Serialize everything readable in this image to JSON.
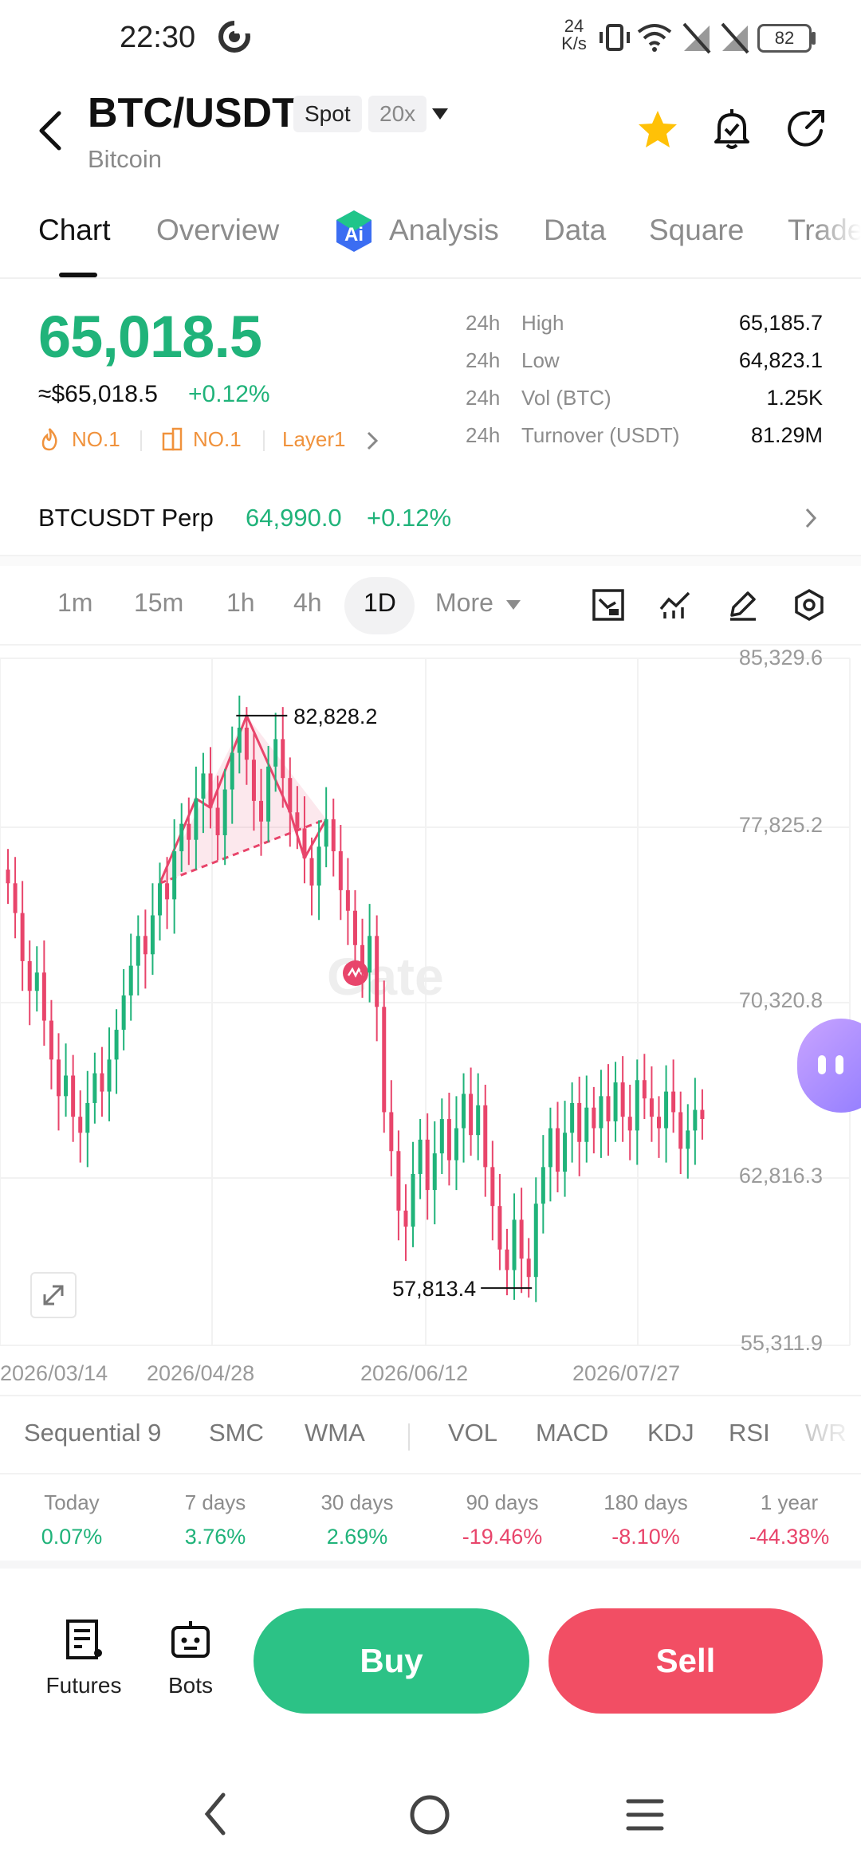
{
  "status_bar": {
    "time": "22:30",
    "net_speed_top": "24",
    "net_speed_bottom": "K/s",
    "battery": "82"
  },
  "header": {
    "title": "BTC/USDT",
    "subtitle": "Bitcoin",
    "spot_chip": "Spot",
    "leverage_chip": "20x"
  },
  "tabs": [
    {
      "label": "Chart"
    },
    {
      "label": "Overview"
    },
    {
      "label": "Analysis"
    },
    {
      "label": "Data"
    },
    {
      "label": "Square"
    },
    {
      "label": "Trade"
    }
  ],
  "price": {
    "last": "65,018.5",
    "usd": "≈$65,018.5",
    "change": "+0.12%",
    "tags": [
      "NO.1",
      "NO.1",
      "Layer1"
    ]
  },
  "stats": [
    {
      "period": "24h",
      "key": "High",
      "value": "65,185.7"
    },
    {
      "period": "24h",
      "key": "Low",
      "value": "64,823.1"
    },
    {
      "period": "24h",
      "key": "Vol (BTC)",
      "value": "1.25K"
    },
    {
      "period": "24h",
      "key": "Turnover (USDT)",
      "value": "81.29M"
    }
  ],
  "perp": {
    "name": "BTCUSDT Perp",
    "price": "64,990.0",
    "change": "+0.12%"
  },
  "timeframes": [
    "1m",
    "15m",
    "1h",
    "4h",
    "1D",
    "More"
  ],
  "chart_data": {
    "type": "candlestick",
    "y_ticks": [
      "85,329.6",
      "77,825.2",
      "70,320.8",
      "62,816.3",
      "55,311.9"
    ],
    "x_ticks": [
      "2026/03/14",
      "2026/04/28",
      "2026/06/12",
      "2026/07/27"
    ],
    "high_label": "82,828.2",
    "low_label": "57,813.4",
    "watermark": "Gate",
    "ylim": [
      55311.9,
      85329.6
    ],
    "closes": [
      75500,
      74200,
      72100,
      70800,
      71600,
      69500,
      67800,
      66200,
      67100,
      65300,
      64600,
      65900,
      67200,
      66400,
      67800,
      69100,
      70600,
      71900,
      73200,
      72400,
      74100,
      75500,
      74800,
      76900,
      78100,
      77400,
      79200,
      80300,
      78800,
      77600,
      79600,
      81200,
      82300,
      80900,
      79100,
      78200,
      80600,
      81800,
      80100,
      78600,
      77900,
      76600,
      75400,
      77100,
      78300,
      76900,
      75200,
      74300,
      72800,
      71600,
      73200,
      70100,
      65500,
      63800,
      61200,
      60500,
      62800,
      64300,
      62100,
      63700,
      65200,
      63400,
      64800,
      66300,
      64500,
      65800,
      63100,
      61400,
      59500,
      58600,
      60800,
      59100,
      58300,
      61500,
      63100,
      64800,
      62900,
      64600,
      65900,
      64200,
      65700,
      64800,
      66200,
      65100,
      66800,
      65300,
      64700,
      66900,
      66100,
      65300,
      64800,
      66400,
      65500,
      63900,
      64700,
      65600,
      65200
    ],
    "series_labels": [],
    "pattern": "Head and shoulders top drawing"
  },
  "indicators": [
    "Sequential 9",
    "SMC",
    "WMA",
    "VOL",
    "MACD",
    "KDJ",
    "RSI",
    "WR"
  ],
  "performance": [
    {
      "label": "Today",
      "value": "0.07%",
      "dir": "up"
    },
    {
      "label": "7 days",
      "value": "3.76%",
      "dir": "up"
    },
    {
      "label": "30 days",
      "value": "2.69%",
      "dir": "up"
    },
    {
      "label": "90 days",
      "value": "-19.46%",
      "dir": "down"
    },
    {
      "label": "180 days",
      "value": "-8.10%",
      "dir": "down"
    },
    {
      "label": "1 year",
      "value": "-44.38%",
      "dir": "down"
    }
  ],
  "bottom": {
    "futures": "Futures",
    "bots": "Bots",
    "buy": "Buy",
    "sell": "Sell"
  },
  "colors": {
    "up": "#20b37a",
    "down": "#e8456b",
    "accent_tag": "#f0923c",
    "buy_bg": "#2cc286",
    "sell_bg": "#f24e64",
    "star": "#ffc107"
  }
}
